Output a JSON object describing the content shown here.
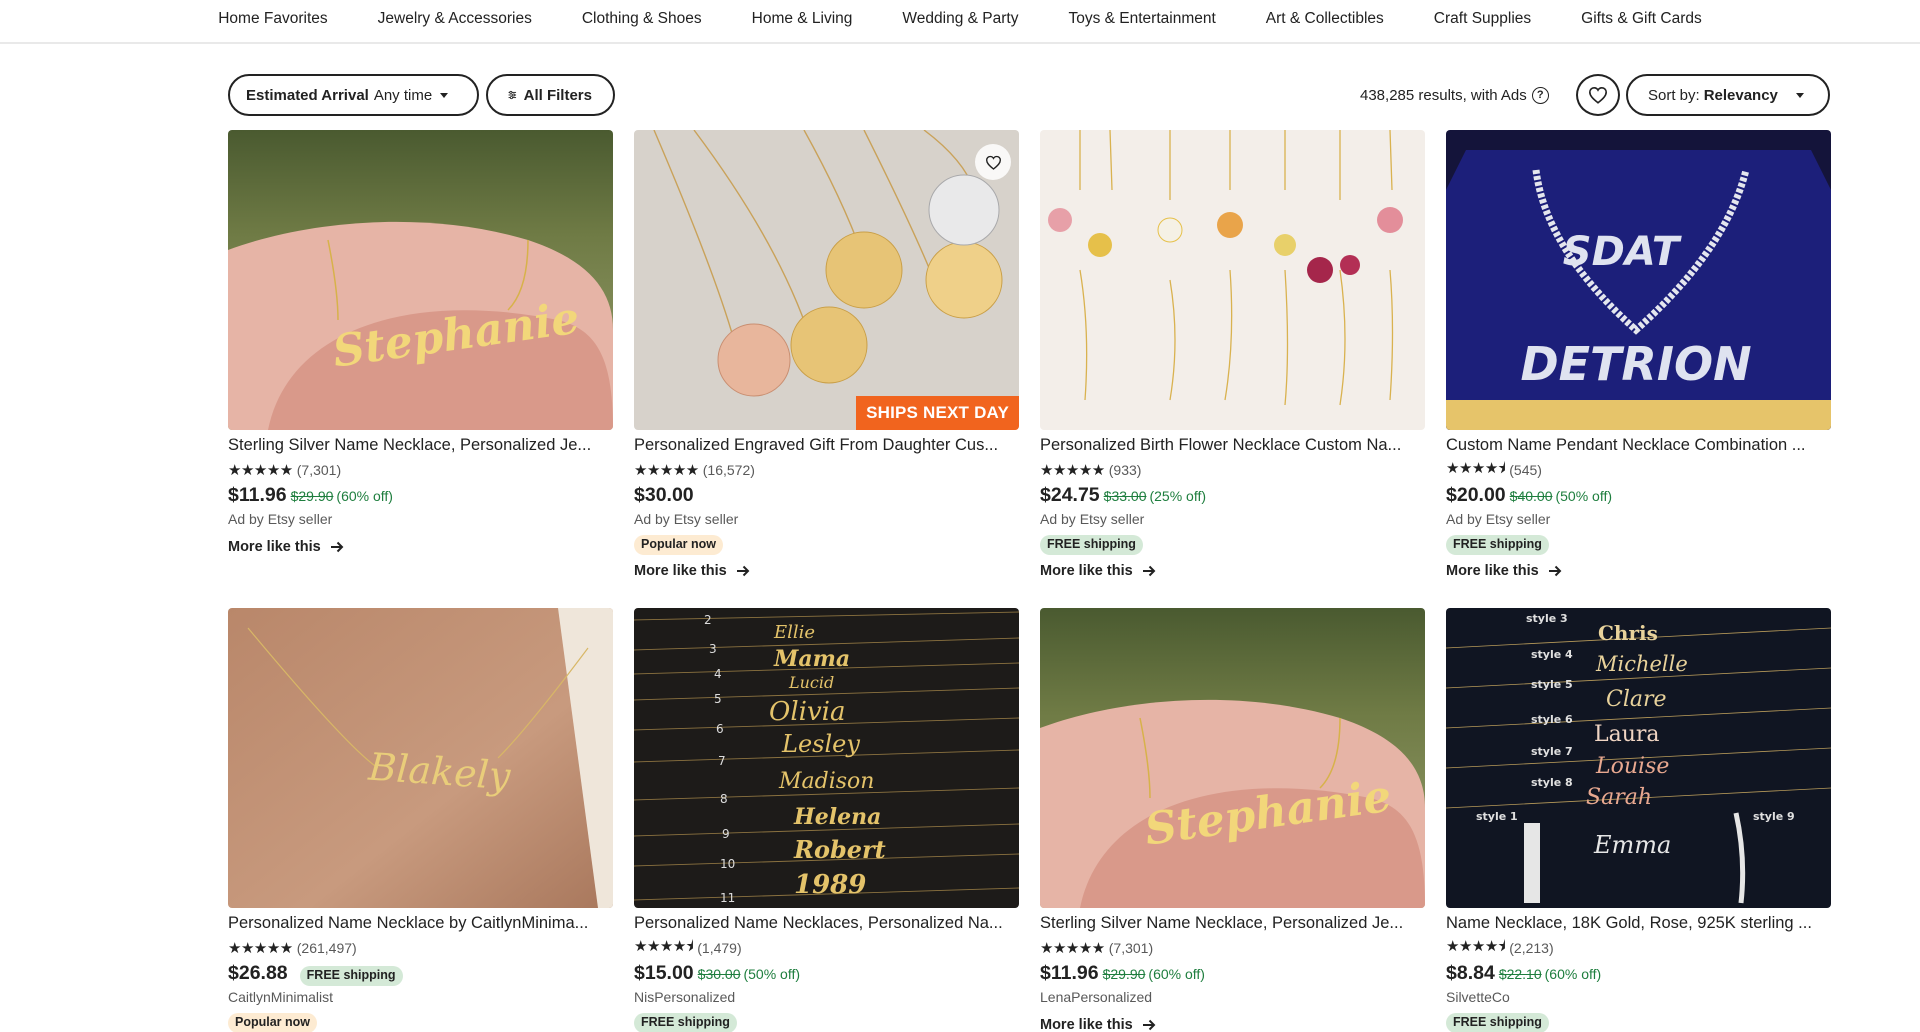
{
  "nav": {
    "items": [
      "Home Favorites",
      "Jewelry & Accessories",
      "Clothing & Shoes",
      "Home & Living",
      "Wedding & Party",
      "Toys & Entertainment",
      "Art & Collectibles",
      "Craft Supplies",
      "Gifts & Gift Cards"
    ]
  },
  "filters": {
    "arrival_label": "Estimated Arrival",
    "arrival_value": "Any time",
    "all_filters": "All Filters",
    "results": "438,285 results, with Ads",
    "help": "?",
    "sort_label": "Sort by:",
    "sort_value": "Relevancy"
  },
  "colors": {
    "accent": "#f1641e",
    "discount_green": "#1e7e3e",
    "free_shipping_bg": "#d4e9d7",
    "popular_bg": "#fdebd2"
  },
  "listings": [
    {
      "title": "Sterling Silver Name Necklace, Personalized Je...",
      "stars": "★★★★★",
      "reviews": "(7,301)",
      "price": "$11.96",
      "original": "$29.90",
      "discount": "(60% off)",
      "seller": "Ad by Etsy seller",
      "badge": "",
      "more": "More like this",
      "image_text": "Stephanie"
    },
    {
      "title": "Personalized Engraved Gift From Daughter Cus...",
      "stars": "★★★★★",
      "reviews": "(16,572)",
      "price": "$30.00",
      "original": "",
      "discount": "",
      "seller": "Ad by Etsy seller",
      "badge": "Popular now",
      "more": "More like this",
      "ships": "SHIPS NEXT DAY"
    },
    {
      "title": "Personalized Birth Flower Necklace Custom Na...",
      "stars": "★★★★★",
      "reviews": "(933)",
      "price": "$24.75",
      "original": "$33.00",
      "discount": "(25% off)",
      "seller": "Ad by Etsy seller",
      "badge": "FREE shipping",
      "more": "More like this"
    },
    {
      "title": "Custom Name Pendant Necklace Combination ...",
      "stars": "★★★★⯨",
      "reviews": "(545)",
      "price": "$20.00",
      "original": "$40.00",
      "discount": "(50% off)",
      "seller": "Ad by Etsy seller",
      "badge": "FREE shipping",
      "more": "More like this",
      "image_text": "SDAT",
      "image_text2": "DETRION"
    },
    {
      "title": "Personalized Name Necklace by CaitlynMinima...",
      "stars": "★★★★★",
      "reviews": "(261,497)",
      "price": "$26.88",
      "original": "",
      "discount": "",
      "price_badge": "FREE shipping",
      "seller": "CaitlynMinimalist",
      "badge": "Popular now",
      "image_text": "Blakely"
    },
    {
      "title": "Personalized Name Necklaces, Personalized Na...",
      "stars": "★★★★⯨",
      "reviews": "(1,479)",
      "price": "$15.00",
      "original": "$30.00",
      "discount": "(50% off)",
      "seller": "NisPersonalized",
      "badge": "FREE shipping",
      "image_names": [
        "Ellie",
        "Mama",
        "Lucid",
        "Olivia",
        "Lesley",
        "Madison",
        "Helena",
        "Robert",
        "1989"
      ]
    },
    {
      "title": "Sterling Silver Name Necklace, Personalized Je...",
      "stars": "★★★★★",
      "reviews": "(7,301)",
      "price": "$11.96",
      "original": "$29.90",
      "discount": "(60% off)",
      "seller": "LenaPersonalized",
      "badge": "",
      "more": "More like this",
      "image_text": "Stephanie"
    },
    {
      "title": "Name Necklace, 18K Gold, Rose, 925K sterling ...",
      "stars": "★★★★⯨",
      "reviews": "(2,213)",
      "price": "$8.84",
      "original": "$22.10",
      "discount": "(60% off)",
      "seller": "SilvetteCo",
      "badge": "FREE shipping",
      "image_names": [
        "Chris",
        "Michelle",
        "Clare",
        "Laura",
        "Louise",
        "Sarah",
        "Emma"
      ]
    }
  ]
}
